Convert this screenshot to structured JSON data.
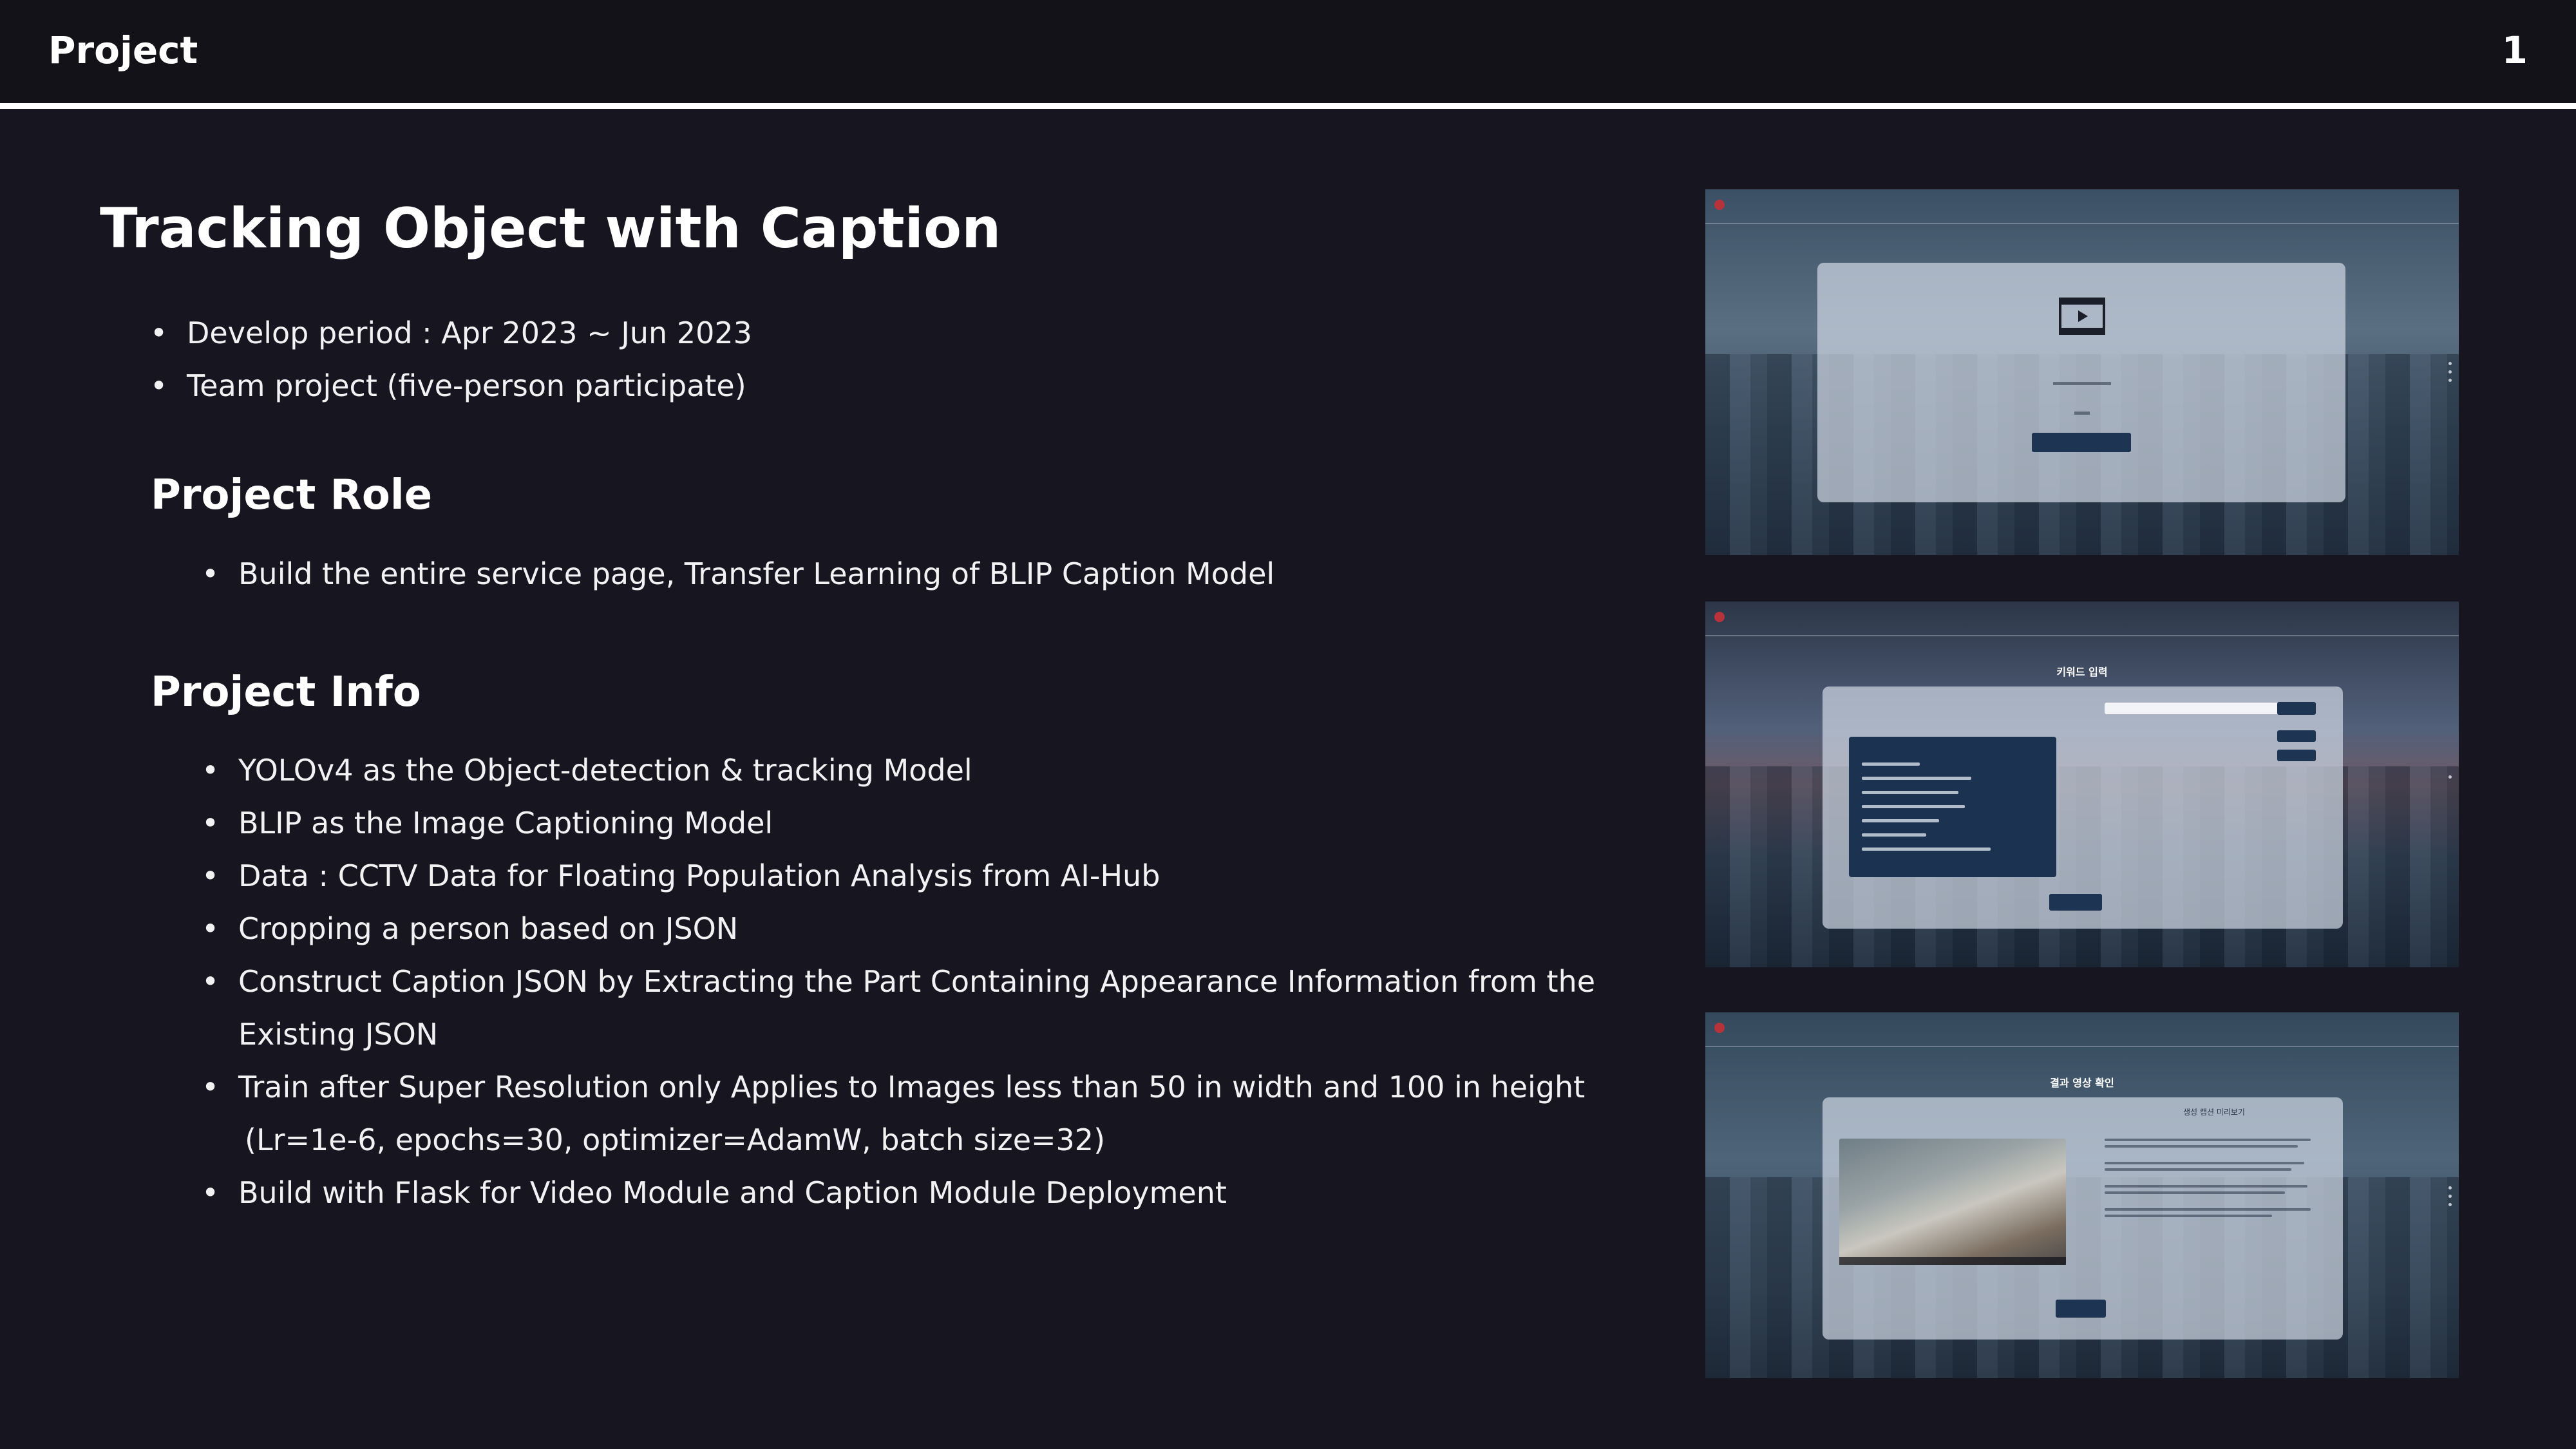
{
  "header": {
    "title": "Project",
    "page_number": "1"
  },
  "main": {
    "title": "Tracking Object with Caption",
    "overview": [
      "Develop period : Apr 2023 ~ Jun 2023",
      "Team project (five-person participate)"
    ],
    "role_section": {
      "title": "Project Role",
      "items": [
        "Build the entire service page, Transfer Learning of BLIP Caption Model"
      ]
    },
    "info_section": {
      "title": "Project Info",
      "items": [
        "YOLOv4 as the Object-detection & tracking Model",
        "BLIP as the Image Captioning Model",
        "Data : CCTV Data for Floating Population Analysis from AI-Hub",
        "Cropping a person based on JSON",
        "Construct Caption JSON by Extracting the Part Containing Appearance Information from the",
        "Existing JSON",
        "Train after Super Resolution only Applies to Images less than 50 in width and 100 in height",
        "(Lr=1e-6, epochs=30, optimizer=AdamW, batch size=32)",
        "Build with Flask for Video Module and Caption Module Deployment"
      ]
    }
  },
  "screenshots": [
    {
      "icon": "film-play-icon"
    },
    {
      "title": "키워드 입력"
    },
    {
      "title": "결과 영상 확인",
      "subtitle": "생성 캡션 미리보기"
    }
  ],
  "colors": {
    "background": "#17151f",
    "header_bg": "#131219",
    "text": "#ffffff"
  }
}
